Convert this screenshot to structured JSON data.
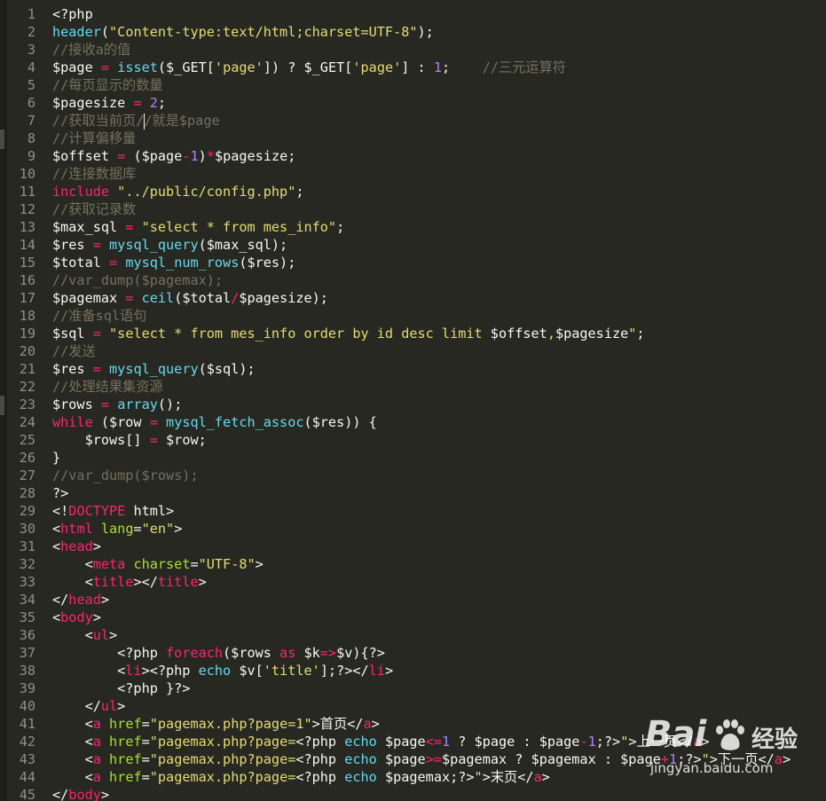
{
  "editor": {
    "colors": {
      "background": "#272822",
      "gutter_text": "#8f908a",
      "default": "#f8f8f2",
      "comment": "#75715e",
      "string": "#e6db74",
      "keyword": "#f92672",
      "function": "#66d9ef",
      "number": "#ae81ff",
      "attribute": "#a6e22e"
    },
    "lines": [
      {
        "n": "1",
        "t": [
          [
            "<?php",
            "d"
          ]
        ]
      },
      {
        "n": "2",
        "t": [
          [
            "header",
            "f"
          ],
          [
            "(",
            "d"
          ],
          [
            "\"Content-type:text/html;charset=UTF-8\"",
            "s"
          ],
          [
            ");",
            "d"
          ]
        ]
      },
      {
        "n": "3",
        "t": [
          [
            "//接收a的值",
            "c"
          ]
        ]
      },
      {
        "n": "4",
        "t": [
          [
            "$page ",
            "d"
          ],
          [
            "=",
            "k"
          ],
          [
            " ",
            "d"
          ],
          [
            "isset",
            "f"
          ],
          [
            "($_GET[",
            "d"
          ],
          [
            "'page'",
            "s"
          ],
          [
            "]) ? $_GET[",
            "d"
          ],
          [
            "'page'",
            "s"
          ],
          [
            "] : ",
            "d"
          ],
          [
            "1",
            "n"
          ],
          [
            ";    ",
            "d"
          ],
          [
            "//三元运算符",
            "c"
          ]
        ]
      },
      {
        "n": "5",
        "t": [
          [
            "//每页显示的数量",
            "c"
          ]
        ]
      },
      {
        "n": "6",
        "t": [
          [
            "$pagesize ",
            "d"
          ],
          [
            "=",
            "k"
          ],
          [
            " ",
            "d"
          ],
          [
            "2",
            "n"
          ],
          [
            ";",
            "d"
          ]
        ]
      },
      {
        "n": "7",
        "t": [
          [
            "//获取当前页//就是$page",
            "c"
          ]
        ]
      },
      {
        "n": "8",
        "t": [
          [
            "//计算偏移量",
            "c"
          ]
        ]
      },
      {
        "n": "9",
        "t": [
          [
            "$offset ",
            "d"
          ],
          [
            "=",
            "k"
          ],
          [
            " ($page",
            "d"
          ],
          [
            "-",
            "k"
          ],
          [
            "1",
            "n"
          ],
          [
            ")",
            "d"
          ],
          [
            "*",
            "k"
          ],
          [
            "$pagesize;",
            "d"
          ]
        ]
      },
      {
        "n": "10",
        "t": [
          [
            "//连接数据库",
            "c"
          ]
        ]
      },
      {
        "n": "11",
        "t": [
          [
            "include",
            "k"
          ],
          [
            " ",
            "d"
          ],
          [
            "\"../public/config.php\"",
            "s"
          ],
          [
            ";",
            "d"
          ]
        ]
      },
      {
        "n": "12",
        "t": [
          [
            "//获取记录数",
            "c"
          ]
        ]
      },
      {
        "n": "13",
        "t": [
          [
            "$max_sql ",
            "d"
          ],
          [
            "=",
            "k"
          ],
          [
            " ",
            "d"
          ],
          [
            "\"select * from mes_info\"",
            "s"
          ],
          [
            ";",
            "d"
          ]
        ]
      },
      {
        "n": "14",
        "t": [
          [
            "$res ",
            "d"
          ],
          [
            "=",
            "k"
          ],
          [
            " ",
            "d"
          ],
          [
            "mysql_query",
            "f"
          ],
          [
            "($max_sql);",
            "d"
          ]
        ]
      },
      {
        "n": "15",
        "t": [
          [
            "$total ",
            "d"
          ],
          [
            "=",
            "k"
          ],
          [
            " ",
            "d"
          ],
          [
            "mysql_num_rows",
            "f"
          ],
          [
            "($res);",
            "d"
          ]
        ]
      },
      {
        "n": "16",
        "t": [
          [
            "//var_dump($pagemax);",
            "c"
          ]
        ]
      },
      {
        "n": "17",
        "t": [
          [
            "$pagemax ",
            "d"
          ],
          [
            "=",
            "k"
          ],
          [
            " ",
            "d"
          ],
          [
            "ceil",
            "f"
          ],
          [
            "($total",
            "d"
          ],
          [
            "/",
            "k"
          ],
          [
            "$pagesize);",
            "d"
          ]
        ]
      },
      {
        "n": "18",
        "t": [
          [
            "//准备sql语句",
            "c"
          ]
        ]
      },
      {
        "n": "19",
        "t": [
          [
            "$sql ",
            "d"
          ],
          [
            "=",
            "k"
          ],
          [
            " ",
            "d"
          ],
          [
            "\"select * from mes_info order by id desc limit ",
            "s"
          ],
          [
            "$offset",
            "d"
          ],
          [
            ",",
            "s"
          ],
          [
            "$pagesize",
            "d"
          ],
          [
            "\"",
            "s"
          ],
          [
            ";",
            "d"
          ]
        ]
      },
      {
        "n": "20",
        "t": [
          [
            "//发送",
            "c"
          ]
        ]
      },
      {
        "n": "21",
        "t": [
          [
            "$res ",
            "d"
          ],
          [
            "=",
            "k"
          ],
          [
            " ",
            "d"
          ],
          [
            "mysql_query",
            "f"
          ],
          [
            "($sql);",
            "d"
          ]
        ]
      },
      {
        "n": "22",
        "t": [
          [
            "//处理结果集资源",
            "c"
          ]
        ]
      },
      {
        "n": "23",
        "t": [
          [
            "$rows ",
            "d"
          ],
          [
            "=",
            "k"
          ],
          [
            " ",
            "d"
          ],
          [
            "array",
            "f"
          ],
          [
            "();",
            "d"
          ]
        ]
      },
      {
        "n": "24",
        "t": [
          [
            "while",
            "k"
          ],
          [
            " ($row ",
            "d"
          ],
          [
            "=",
            "k"
          ],
          [
            " ",
            "d"
          ],
          [
            "mysql_fetch_assoc",
            "f"
          ],
          [
            "($res)) {",
            "d"
          ]
        ]
      },
      {
        "n": "25",
        "t": [
          [
            "    $rows[] ",
            "d"
          ],
          [
            "=",
            "k"
          ],
          [
            " $row;",
            "d"
          ]
        ]
      },
      {
        "n": "26",
        "t": [
          [
            "}",
            "d"
          ]
        ]
      },
      {
        "n": "27",
        "t": [
          [
            "//var_dump($rows);",
            "c"
          ]
        ]
      },
      {
        "n": "28",
        "t": [
          [
            "?>",
            "d"
          ]
        ]
      },
      {
        "n": "29",
        "t": [
          [
            "<!",
            "d"
          ],
          [
            "DOCTYPE",
            "k"
          ],
          [
            " html>",
            "d"
          ]
        ]
      },
      {
        "n": "30",
        "t": [
          [
            "<",
            "d"
          ],
          [
            "html",
            "k"
          ],
          [
            " ",
            "d"
          ],
          [
            "lang",
            "a"
          ],
          [
            "=",
            "d"
          ],
          [
            "\"en\"",
            "s"
          ],
          [
            ">",
            "d"
          ]
        ]
      },
      {
        "n": "31",
        "t": [
          [
            "<",
            "d"
          ],
          [
            "head",
            "k"
          ],
          [
            ">",
            "d"
          ]
        ]
      },
      {
        "n": "32",
        "t": [
          [
            "    <",
            "d"
          ],
          [
            "meta",
            "k"
          ],
          [
            " ",
            "d"
          ],
          [
            "charset",
            "a"
          ],
          [
            "=",
            "d"
          ],
          [
            "\"UTF-8\"",
            "s"
          ],
          [
            ">",
            "d"
          ]
        ]
      },
      {
        "n": "33",
        "t": [
          [
            "    <",
            "d"
          ],
          [
            "title",
            "k"
          ],
          [
            "></",
            "d"
          ],
          [
            "title",
            "k"
          ],
          [
            ">",
            "d"
          ]
        ]
      },
      {
        "n": "34",
        "t": [
          [
            "</",
            "d"
          ],
          [
            "head",
            "k"
          ],
          [
            ">",
            "d"
          ]
        ]
      },
      {
        "n": "35",
        "t": [
          [
            "<",
            "d"
          ],
          [
            "body",
            "k"
          ],
          [
            ">",
            "d"
          ]
        ]
      },
      {
        "n": "36",
        "t": [
          [
            "    <",
            "d"
          ],
          [
            "ul",
            "k"
          ],
          [
            ">",
            "d"
          ]
        ]
      },
      {
        "n": "37",
        "t": [
          [
            "        <?php ",
            "d"
          ],
          [
            "foreach",
            "k"
          ],
          [
            "($rows ",
            "d"
          ],
          [
            "as",
            "k"
          ],
          [
            " $k",
            "d"
          ],
          [
            "=>",
            "k"
          ],
          [
            "$v){?>",
            "d"
          ]
        ]
      },
      {
        "n": "38",
        "t": [
          [
            "        <",
            "d"
          ],
          [
            "li",
            "k"
          ],
          [
            "><?php ",
            "d"
          ],
          [
            "echo",
            "f"
          ],
          [
            " $v[",
            "d"
          ],
          [
            "'title'",
            "s"
          ],
          [
            "];?></",
            "d"
          ],
          [
            "li",
            "k"
          ],
          [
            ">",
            "d"
          ]
        ]
      },
      {
        "n": "39",
        "t": [
          [
            "        <?php }?>",
            "d"
          ]
        ]
      },
      {
        "n": "40",
        "t": [
          [
            "    </",
            "d"
          ],
          [
            "ul",
            "k"
          ],
          [
            ">",
            "d"
          ]
        ]
      },
      {
        "n": "41",
        "t": [
          [
            "    <",
            "d"
          ],
          [
            "a",
            "k"
          ],
          [
            " ",
            "d"
          ],
          [
            "href",
            "a"
          ],
          [
            "=",
            "d"
          ],
          [
            "\"pagemax.php?page=1\"",
            "s"
          ],
          [
            ">首页</",
            "d"
          ],
          [
            "a",
            "k"
          ],
          [
            ">",
            "d"
          ]
        ]
      },
      {
        "n": "42",
        "t": [
          [
            "    <",
            "d"
          ],
          [
            "a",
            "k"
          ],
          [
            " ",
            "d"
          ],
          [
            "href",
            "a"
          ],
          [
            "=",
            "d"
          ],
          [
            "\"pagemax.php?page=",
            "s"
          ],
          [
            "<?php ",
            "d"
          ],
          [
            "echo",
            "f"
          ],
          [
            " $page",
            "d"
          ],
          [
            "<=",
            "k"
          ],
          [
            "1",
            "n"
          ],
          [
            " ? $page : $page",
            "d"
          ],
          [
            "-",
            "k"
          ],
          [
            "1",
            "n"
          ],
          [
            ";?>",
            "d"
          ],
          [
            "\"",
            "s"
          ],
          [
            ">上一页</",
            "d"
          ],
          [
            "a",
            "k"
          ],
          [
            ">",
            "d"
          ]
        ]
      },
      {
        "n": "43",
        "t": [
          [
            "    <",
            "d"
          ],
          [
            "a",
            "k"
          ],
          [
            " ",
            "d"
          ],
          [
            "href",
            "a"
          ],
          [
            "=",
            "d"
          ],
          [
            "\"pagemax.php?page=",
            "s"
          ],
          [
            "<?php ",
            "d"
          ],
          [
            "echo",
            "f"
          ],
          [
            " $page",
            "d"
          ],
          [
            ">=",
            "k"
          ],
          [
            "$pagemax ? $pagemax : $page",
            "d"
          ],
          [
            "+",
            "k"
          ],
          [
            "1",
            "n"
          ],
          [
            ";?>",
            "d"
          ],
          [
            "\"",
            "s"
          ],
          [
            ">下一页</",
            "d"
          ],
          [
            "a",
            "k"
          ],
          [
            ">",
            "d"
          ]
        ]
      },
      {
        "n": "44",
        "t": [
          [
            "    <",
            "d"
          ],
          [
            "a",
            "k"
          ],
          [
            " ",
            "d"
          ],
          [
            "href",
            "a"
          ],
          [
            "=",
            "d"
          ],
          [
            "\"pagemax.php?page=",
            "s"
          ],
          [
            "<?php ",
            "d"
          ],
          [
            "echo",
            "f"
          ],
          [
            " $pagemax;?>",
            "d"
          ],
          [
            "\"",
            "s"
          ],
          [
            ">末页</",
            "d"
          ],
          [
            "a",
            "k"
          ],
          [
            ">",
            "d"
          ]
        ]
      },
      {
        "n": "45",
        "t": [
          [
            "</",
            "d"
          ],
          [
            "body",
            "k"
          ],
          [
            ">",
            "d"
          ]
        ]
      }
    ]
  },
  "watermark": {
    "logo_text": "Bai",
    "logo_icon": "paw-icon",
    "brand_text": "经验",
    "url_text": "jingyan.baidu.com"
  }
}
